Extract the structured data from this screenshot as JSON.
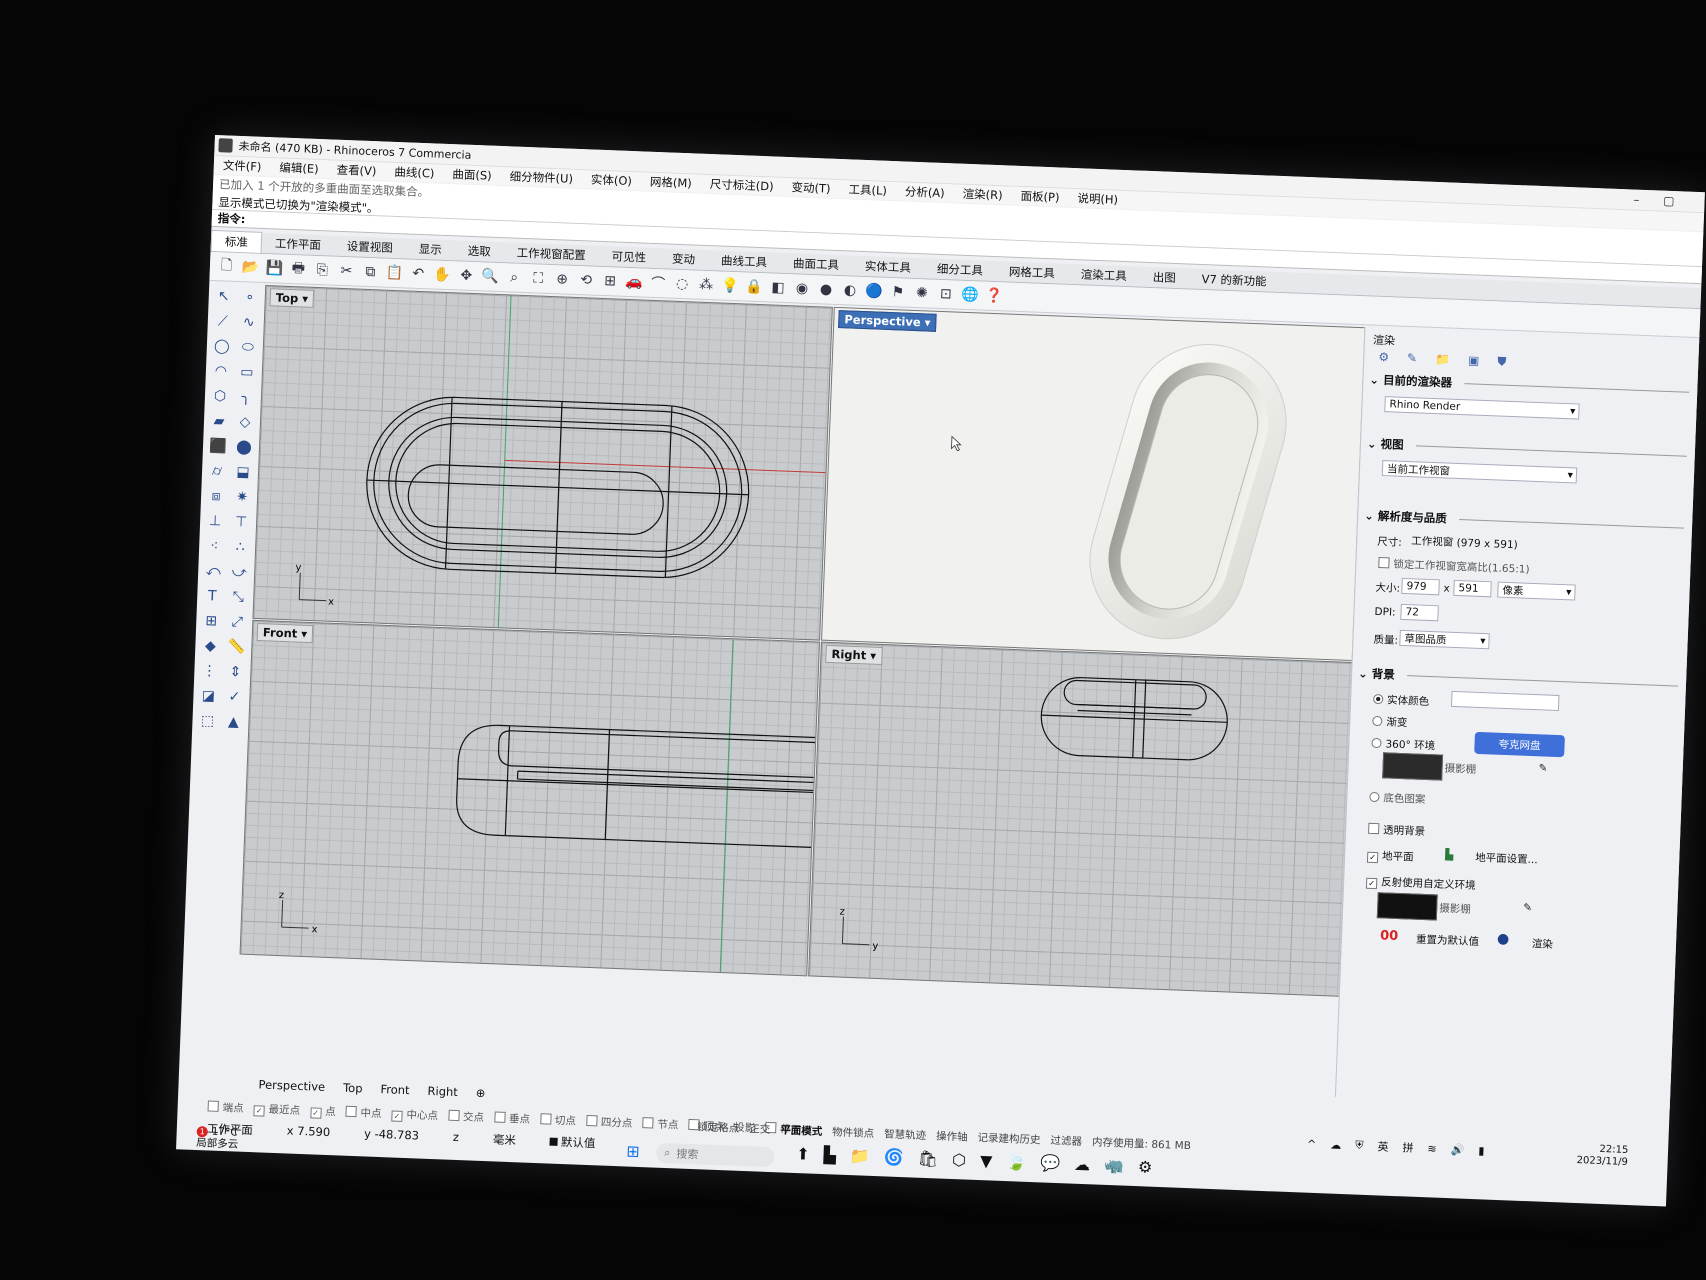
{
  "window": {
    "title": "未命名 (470 KB) - Rhinoceros 7 Commercia",
    "controls": [
      "–",
      "▢"
    ]
  },
  "menu": [
    "文件(F)",
    "编辑(E)",
    "查看(V)",
    "曲线(C)",
    "曲面(S)",
    "细分物件(U)",
    "实体(O)",
    "网格(M)",
    "尺寸标注(D)",
    "变动(T)",
    "工具(L)",
    "分析(A)",
    "渲染(R)",
    "面板(P)",
    "说明(H)"
  ],
  "command": {
    "history_1": "已加入 1 个开放的多重曲面至选取集合。",
    "history_2": "显示模式已切换为\"渲染模式\"。",
    "prompt": "指令:"
  },
  "tabs": [
    "标准",
    "工作平面",
    "设置视图",
    "显示",
    "选取",
    "工作视窗配置",
    "可见性",
    "变动",
    "曲线工具",
    "曲面工具",
    "实体工具",
    "细分工具",
    "网格工具",
    "渲染工具",
    "出图",
    "V7 的新功能"
  ],
  "active_tab": "标准",
  "viewports": {
    "top": {
      "label": "Top",
      "axis_1": "y",
      "axis_2": "x"
    },
    "perspective": {
      "label": "Perspective"
    },
    "front": {
      "label": "Front",
      "axis_1": "z",
      "axis_2": "x"
    },
    "right": {
      "label": "Right",
      "axis_1": "z",
      "axis_2": "y"
    }
  },
  "render_panel": {
    "title": "渲染",
    "current_renderer": {
      "section": "目前的渲染器",
      "value": "Rhino Render"
    },
    "view": {
      "section": "视图",
      "value": "当前工作视窗"
    },
    "resolution": {
      "section": "解析度与品质",
      "size_label": "尺寸:",
      "size_value": "工作视窗 (979 x 591)",
      "lock_label": "锁定工作视窗宽高比(1.65:1)",
      "dims_label": "大小:",
      "width": "979",
      "x": "x",
      "height": "591",
      "unit": "像素",
      "dpi_label": "DPI:",
      "dpi": "72",
      "quality_label": "质量:",
      "quality": "草图品质"
    },
    "background": {
      "section": "背景",
      "solid": "实体颜色",
      "gradient": "渐变",
      "env360": "360° 环境",
      "studio": "摄影棚",
      "wallpaper": "底色图案",
      "transparent": "透明背景",
      "ground": "地平面",
      "ground_settings": "地平面设置...",
      "reflection": "反射使用自定义环境",
      "studio2": "摄影棚",
      "reset": "重置为默认值",
      "render": "渲染",
      "cloud_badge": "夸克网盘"
    }
  },
  "viewport_tabs": [
    "Perspective",
    "Top",
    "Front",
    "Right",
    "⊕"
  ],
  "osnaps": [
    "端点",
    "最近点",
    "点",
    "中点",
    "中心点",
    "交点",
    "垂点",
    "切点",
    "四分点",
    "节点",
    "顶点",
    "投影",
    "停用"
  ],
  "status": {
    "plane": "工作平面",
    "x": "x 7.590",
    "y": "y -48.783",
    "z": "z",
    "unit": "毫米",
    "layer": "默认值"
  },
  "status_modes": [
    "锁定格点",
    "正交",
    "平面模式",
    "物件锁点",
    "智慧轨迹",
    "操作轴",
    "记录建构历史",
    "过滤器",
    "内存使用量: 861 MB"
  ],
  "status_mode_bold": "平面模式",
  "taskbar": {
    "search_placeholder": "搜索",
    "tray_lang_1": "英",
    "tray_lang_2": "拼",
    "time": "22:15",
    "date": "2023/11/9",
    "weather_temp": "17°C",
    "weather_desc": "局部多云",
    "weather_badge": "1"
  },
  "colors": {
    "accent": "#3c6fb6",
    "viewport_bg": "#c9ccce",
    "curve": "#111111"
  }
}
